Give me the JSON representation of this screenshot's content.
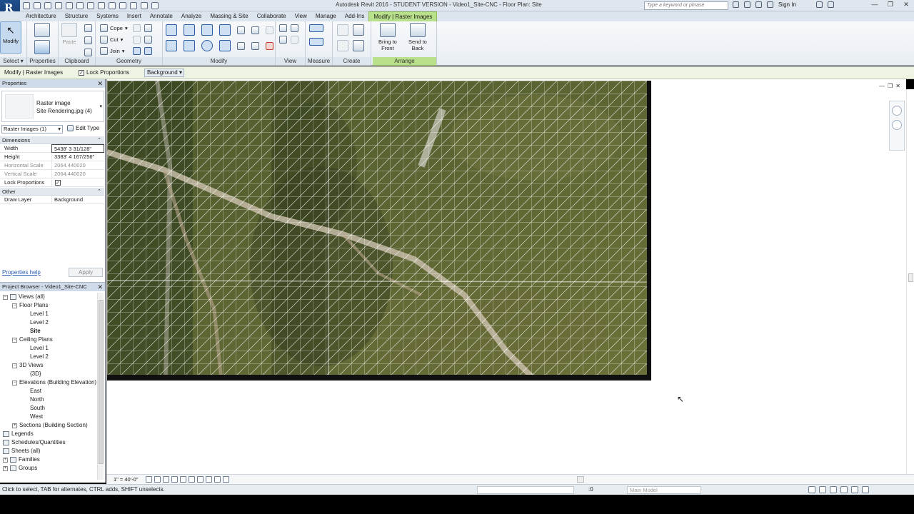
{
  "title_bar": {
    "app_letter": "R",
    "window_title": "Autodesk Revit 2016 - STUDENT VERSION -    Video1_Site-CNC - Floor Plan: Site",
    "search_placeholder": "Type a keyword or phrase",
    "sign_in": "Sign In"
  },
  "ribbon_tabs": [
    "Architecture",
    "Structure",
    "Systems",
    "Insert",
    "Annotate",
    "Analyze",
    "Massing & Site",
    "Collaborate",
    "View",
    "Manage",
    "Add-Ins",
    "Modify | Raster Images"
  ],
  "ribbon": {
    "select_panel": {
      "label": "Select",
      "modify": "Modify"
    },
    "properties_panel": {
      "label": "Properties"
    },
    "clipboard_panel": {
      "label": "Clipboard",
      "paste": "Paste"
    },
    "geometry_panel": {
      "label": "Geometry",
      "cope": "Cope",
      "cut": "Cut",
      "join": "Join"
    },
    "modify_panel": {
      "label": "Modify"
    },
    "view_panel": {
      "label": "View"
    },
    "measure_panel": {
      "label": "Measure"
    },
    "create_panel": {
      "label": "Create"
    },
    "arrange_panel": {
      "label": "Arrange",
      "bring_front_1": "Bring to",
      "bring_front_2": "Front",
      "send_back_1": "Send to",
      "send_back_2": "Back"
    }
  },
  "options_bar": {
    "context": "Modify | Raster Images",
    "lock_proportions": "Lock Proportions",
    "draw_layer": "Background"
  },
  "properties": {
    "title": "Properties",
    "type_line1": "Raster image",
    "type_line2": "Site Rendering.jpg (4)",
    "instance_filter": "Raster Images (1)",
    "edit_type": "Edit Type",
    "sections": [
      {
        "name": "Dimensions",
        "rows": [
          {
            "key": "Width",
            "value": "5438'  3 31/128\""
          },
          {
            "key": "Height",
            "value": "3383'  4 167/256\""
          },
          {
            "key": "Horizontal Scale",
            "value": "2064.440020"
          },
          {
            "key": "Vertical Scale",
            "value": "2064.440020"
          },
          {
            "key": "Lock Proportions",
            "value": "✓"
          }
        ]
      },
      {
        "name": "Other",
        "rows": [
          {
            "key": "Draw Layer",
            "value": "Background"
          }
        ]
      }
    ],
    "help": "Properties help",
    "apply": "Apply"
  },
  "project_browser": {
    "title": "Project Browser - Video1_Site-CNC",
    "tree": [
      {
        "label": "Views (all)",
        "level": 0,
        "exp": "−",
        "icon": true
      },
      {
        "label": "Floor Plans",
        "level": 1,
        "exp": "−"
      },
      {
        "label": "Level 1",
        "level": 2
      },
      {
        "label": "Level 2",
        "level": 2
      },
      {
        "label": "Site",
        "level": 2,
        "bold": true
      },
      {
        "label": "Ceiling Plans",
        "level": 1,
        "exp": "−"
      },
      {
        "label": "Level 1",
        "level": 2
      },
      {
        "label": "Level 2",
        "level": 2
      },
      {
        "label": "3D Views",
        "level": 1,
        "exp": "−"
      },
      {
        "label": "{3D}",
        "level": 2
      },
      {
        "label": "Elevations (Building Elevation)",
        "level": 1,
        "exp": "−"
      },
      {
        "label": "East",
        "level": 2
      },
      {
        "label": "North",
        "level": 2
      },
      {
        "label": "South",
        "level": 2
      },
      {
        "label": "West",
        "level": 2
      },
      {
        "label": "Sections (Building Section)",
        "level": 1,
        "exp": "+"
      },
      {
        "label": "Legends",
        "level": 0,
        "icon": true
      },
      {
        "label": "Schedules/Quantities",
        "level": 0,
        "icon": true
      },
      {
        "label": "Sheets (all)",
        "level": 0,
        "icon": true
      },
      {
        "label": "Families",
        "level": 0,
        "exp": "+",
        "icon": true
      },
      {
        "label": "Groups",
        "level": 0,
        "exp": "+",
        "icon": true
      }
    ]
  },
  "view_bar": {
    "scale": "1\" = 40'-0\""
  },
  "status_bar": {
    "message": "Click to select, TAB for alternates, CTRL adds, SHIFT unselects.",
    "zero": ":0",
    "model": "Main Model"
  }
}
